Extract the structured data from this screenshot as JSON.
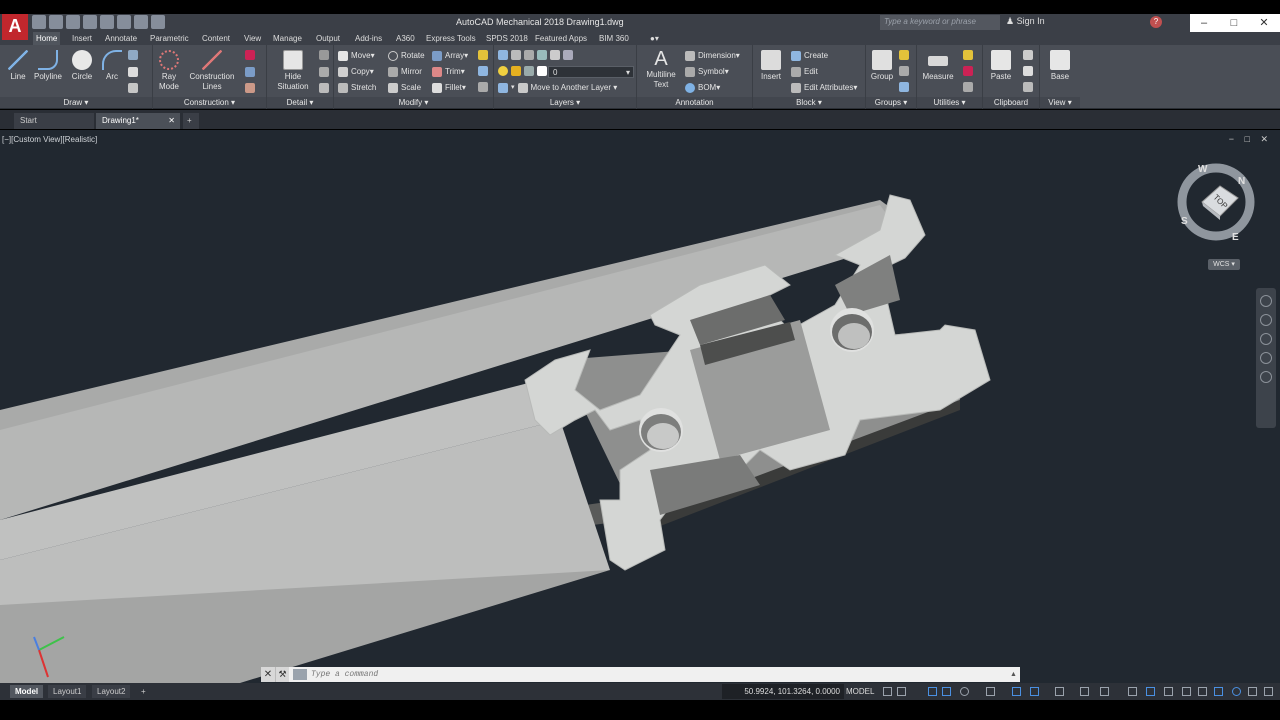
{
  "app": {
    "logo": "A",
    "title": "AutoCAD Mechanical 2018    Drawing1.dwg",
    "search_placeholder": "Type a keyword or phrase",
    "sign_in": "Sign In"
  },
  "ribbon_tabs": [
    "Home",
    "Insert",
    "Annotate",
    "Parametric",
    "Content",
    "View",
    "Manage",
    "Output",
    "Add-ins",
    "A360",
    "Express Tools",
    "SPDS 2018",
    "Featured Apps",
    "BIM 360"
  ],
  "panels": {
    "draw": {
      "title": "Draw",
      "line": "Line",
      "polyline": "Polyline",
      "circle": "Circle",
      "arc": "Arc"
    },
    "construction": {
      "title": "Construction",
      "ray_mode_1": "Ray",
      "ray_mode_2": "Mode",
      "construction_lines_1": "Construction",
      "construction_lines_2": "Lines"
    },
    "detail": {
      "title": "Detail",
      "hide_1": "Hide",
      "hide_2": "Situation"
    },
    "modify": {
      "title": "Modify",
      "move": "Move",
      "rotate": "Rotate",
      "array": "Array",
      "copy": "Copy",
      "mirror": "Mirror",
      "trim": "Trim",
      "stretch": "Stretch",
      "scale": "Scale",
      "fillet": "Fillet"
    },
    "layers": {
      "title": "Layers",
      "current_layer": "0",
      "move_to_layer": "Move to Another Layer"
    },
    "annotation": {
      "title": "Annotation",
      "multiline_1": "Multiline",
      "multiline_2": "Text",
      "dimension": "Dimension",
      "symbol": "Symbol",
      "bom": "BOM"
    },
    "block": {
      "title": "Block",
      "insert": "Insert",
      "create": "Create",
      "edit": "Edit",
      "edit_attributes": "Edit Attributes"
    },
    "groups": {
      "title": "Groups",
      "group": "Group"
    },
    "utilities": {
      "title": "Utilities",
      "measure": "Measure"
    },
    "clipboard": {
      "title": "Clipboard",
      "paste": "Paste"
    },
    "view": {
      "title": "View",
      "base": "Base"
    }
  },
  "doc_tabs": {
    "start": "Start",
    "drawing": "Drawing1*",
    "new_tab": "+"
  },
  "viewport": {
    "label": "[−][Custom View][Realistic]",
    "controls": "− □ ✕",
    "viewcube_face": "TOP",
    "compass": [
      "N",
      "E",
      "S",
      "W"
    ],
    "wcs": "WCS"
  },
  "command": {
    "placeholder": "Type a command"
  },
  "status": {
    "layouts": [
      "Model",
      "Layout1",
      "Layout2"
    ],
    "add_layout": "+",
    "coords": "50.9924, 101.3264, 0.0000",
    "model": "MODEL"
  },
  "colors": {
    "viewport_bg": "#212830",
    "ribbon_bg": "#4a4e56",
    "logo_red": "#c1272d",
    "extrusion_face": "#d4d6d4"
  }
}
